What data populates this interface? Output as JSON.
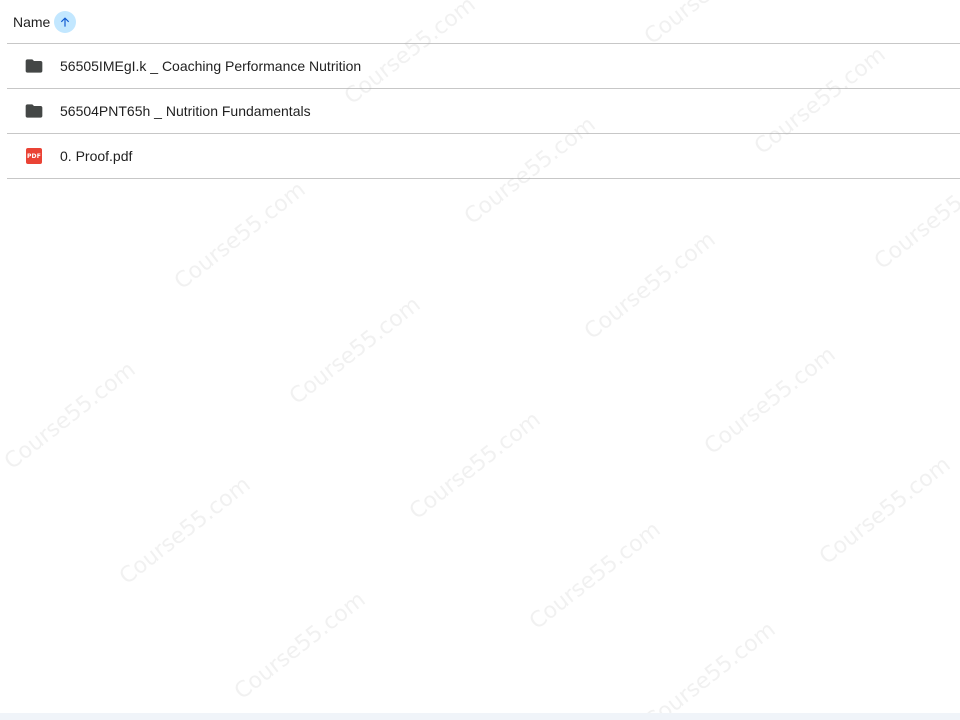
{
  "header": {
    "name_label": "Name",
    "sort_icon": "arrow-up-icon"
  },
  "files": [
    {
      "name": "56505IMEgI.k _ Coaching Performance Nutrition",
      "type": "folder",
      "icon": "folder-icon"
    },
    {
      "name": "56504PNT65h _ Nutrition Fundamentals",
      "type": "folder",
      "icon": "folder-icon"
    },
    {
      "name": "0. Proof.pdf",
      "type": "pdf",
      "icon": "pdf-icon",
      "badge": "PDF"
    }
  ],
  "watermark": "Course55.com",
  "colors": {
    "sort_active_bg": "#c2e7ff",
    "folder": "#444746",
    "pdf": "#ea4335",
    "divider": "#c7c7c7"
  }
}
